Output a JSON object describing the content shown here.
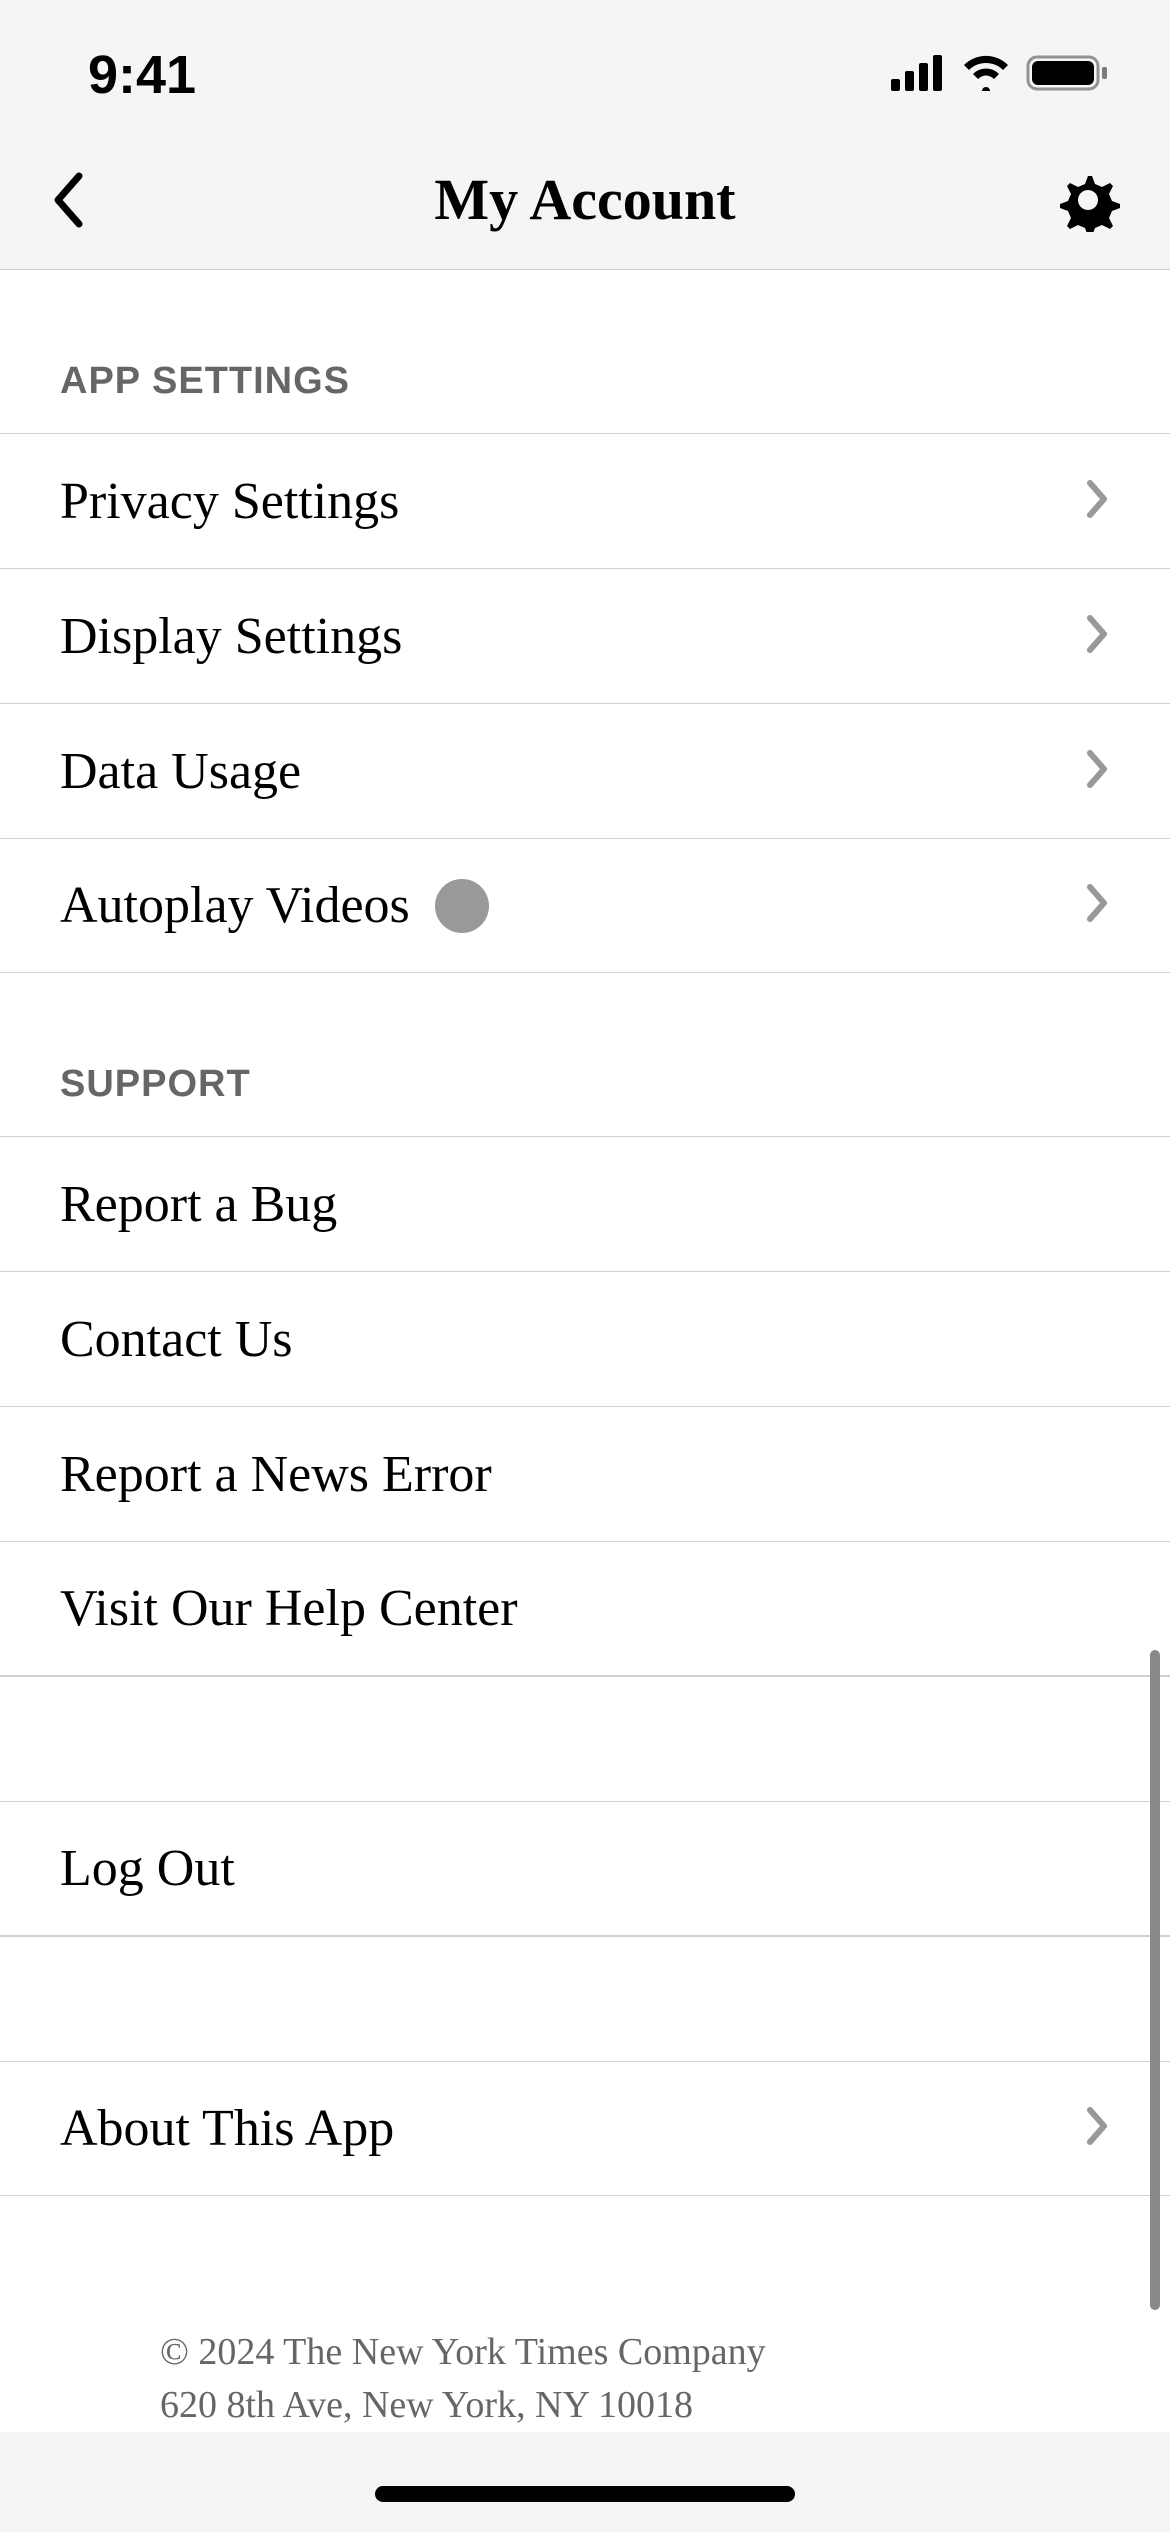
{
  "status": {
    "time": "9:41"
  },
  "nav": {
    "title": "My Account"
  },
  "sections": {
    "app_settings": {
      "header": "APP SETTINGS",
      "items": [
        {
          "label": "Privacy Settings"
        },
        {
          "label": "Display Settings"
        },
        {
          "label": "Data Usage"
        },
        {
          "label": "Autoplay Videos"
        }
      ]
    },
    "support": {
      "header": "SUPPORT",
      "items": [
        {
          "label": "Report a Bug"
        },
        {
          "label": "Contact Us"
        },
        {
          "label": "Report a News Error"
        },
        {
          "label": "Visit Our Help Center"
        }
      ]
    },
    "logout": {
      "label": "Log Out"
    },
    "about": {
      "label": "About This App"
    }
  },
  "footer": {
    "copyright": "© 2024 The New York Times Company",
    "address": "620 8th Ave, New York, NY 10018"
  }
}
